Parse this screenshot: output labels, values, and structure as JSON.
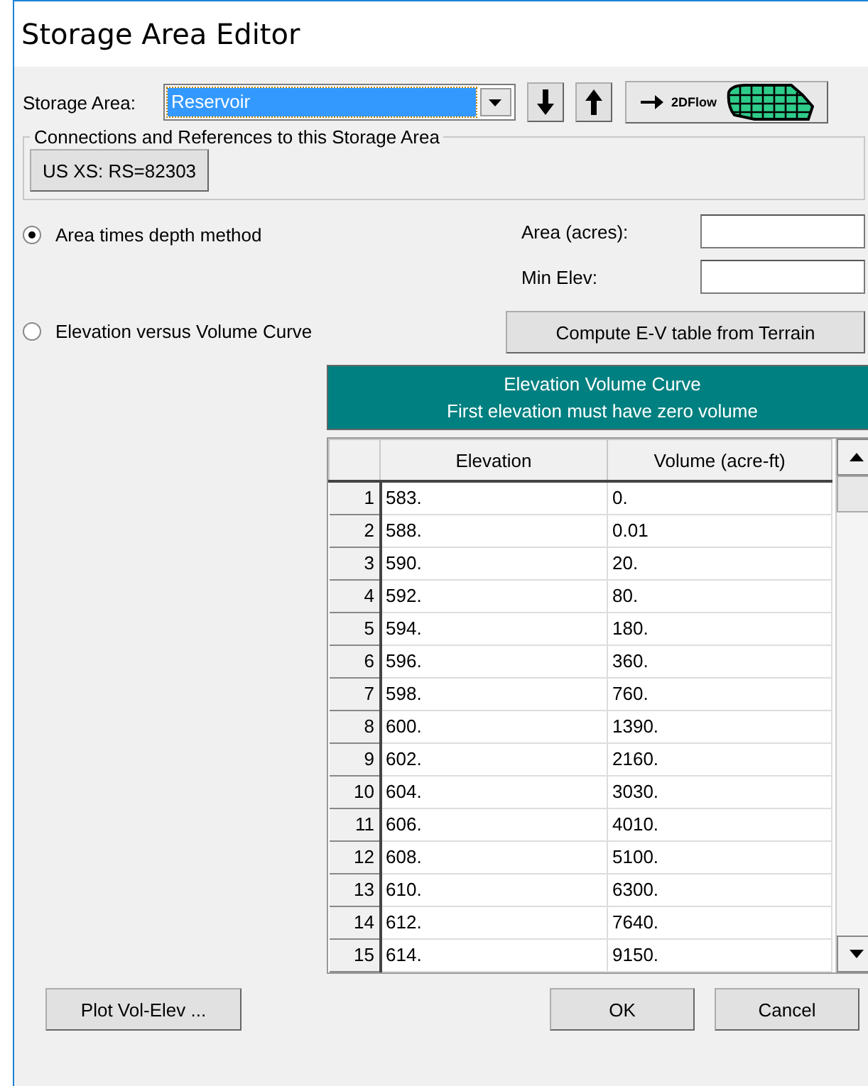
{
  "window": {
    "title": "Storage Area Editor"
  },
  "storage_area": {
    "label": "Storage Area:",
    "value": "Reservoir"
  },
  "nav_buttons": [
    {
      "kind": "down"
    },
    {
      "kind": "up"
    }
  ],
  "flow_button": {
    "label": "2DFlow"
  },
  "connections": {
    "legend": "Connections and References to this Storage Area",
    "buttons": [
      "US XS: RS=82303"
    ]
  },
  "methods": [
    {
      "label": "Area times depth method",
      "selected": true
    },
    {
      "label": "Elevation versus Volume Curve",
      "selected": false
    }
  ],
  "fields": [
    {
      "label": "Area (acres):"
    },
    {
      "label": "Min Elev:"
    }
  ],
  "compute_button": "Compute E-V table from Terrain",
  "table": {
    "title": "Elevation Volume Curve",
    "subtitle": "First elevation must have zero volume",
    "columns": [
      "Elevation",
      "Volume (acre-ft)"
    ],
    "rows": [
      {
        "index": "1",
        "elevation": "583.",
        "volume": "0."
      },
      {
        "index": "2",
        "elevation": "588.",
        "volume": "0.01"
      },
      {
        "index": "3",
        "elevation": "590.",
        "volume": "20."
      },
      {
        "index": "4",
        "elevation": "592.",
        "volume": "80."
      },
      {
        "index": "5",
        "elevation": "594.",
        "volume": "180."
      },
      {
        "index": "6",
        "elevation": "596.",
        "volume": "360."
      },
      {
        "index": "7",
        "elevation": "598.",
        "volume": "760."
      },
      {
        "index": "8",
        "elevation": "600.",
        "volume": "1390."
      },
      {
        "index": "9",
        "elevation": "602.",
        "volume": "2160."
      },
      {
        "index": "10",
        "elevation": "604.",
        "volume": "3030."
      },
      {
        "index": "11",
        "elevation": "606.",
        "volume": "4010."
      },
      {
        "index": "12",
        "elevation": "608.",
        "volume": "5100."
      },
      {
        "index": "13",
        "elevation": "610.",
        "volume": "6300."
      },
      {
        "index": "14",
        "elevation": "612.",
        "volume": "7640."
      },
      {
        "index": "15",
        "elevation": "614.",
        "volume": "9150."
      }
    ]
  },
  "footer_buttons": [
    {
      "kind": "left",
      "label": "Plot Vol-Elev ..."
    },
    {
      "kind": "right",
      "label": "OK"
    },
    {
      "kind": "right",
      "label": "Cancel"
    }
  ]
}
